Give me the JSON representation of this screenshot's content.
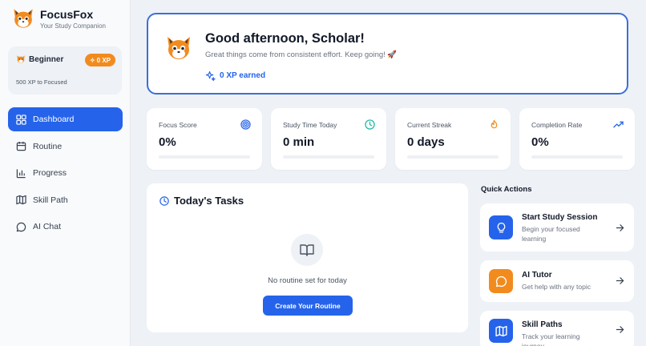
{
  "app": {
    "name": "FocusFox",
    "tagline": "Your Study Companion"
  },
  "level": {
    "name": "Beginner",
    "xp_badge": "0 XP",
    "next_level": "500 XP to Focused"
  },
  "nav": {
    "items": [
      {
        "label": "Dashboard",
        "icon": "dashboard-icon",
        "active": true
      },
      {
        "label": "Routine",
        "icon": "calendar-icon"
      },
      {
        "label": "Progress",
        "icon": "bar-chart-icon"
      },
      {
        "label": "Skill Path",
        "icon": "map-icon"
      },
      {
        "label": "AI Chat",
        "icon": "chat-icon"
      }
    ]
  },
  "welcome": {
    "greeting": "Good afternoon, Scholar!",
    "subtitle": "Great things come from consistent effort. Keep going! 🚀",
    "xp_earned": "0 XP earned"
  },
  "stats": [
    {
      "label": "Focus Score",
      "value": "0%",
      "icon": "target-icon",
      "progress": 0
    },
    {
      "label": "Study Time Today",
      "value": "0 min",
      "icon": "clock-icon",
      "progress": 0
    },
    {
      "label": "Current Streak",
      "value": "0 days",
      "icon": "flame-icon",
      "progress": 0
    },
    {
      "label": "Completion Rate",
      "value": "0%",
      "icon": "trending-up-icon",
      "progress": 0
    }
  ],
  "tasks": {
    "title": "Today's Tasks",
    "empty_text": "No routine set for today",
    "create_label": "Create Your Routine"
  },
  "quick_actions": {
    "title": "Quick Actions",
    "items": [
      {
        "name": "Start Study Session",
        "desc": "Begin your focused learning",
        "icon": "lightbulb-icon",
        "color": "#2563eb"
      },
      {
        "name": "AI Tutor",
        "desc": "Get help with any topic",
        "icon": "chat-icon",
        "color": "#f28b1e"
      },
      {
        "name": "Skill Paths",
        "desc": "Track your learning journey",
        "icon": "map-icon",
        "color": "#2563eb"
      }
    ]
  },
  "colors": {
    "accent": "#2563eb",
    "orange": "#f28b1e"
  }
}
